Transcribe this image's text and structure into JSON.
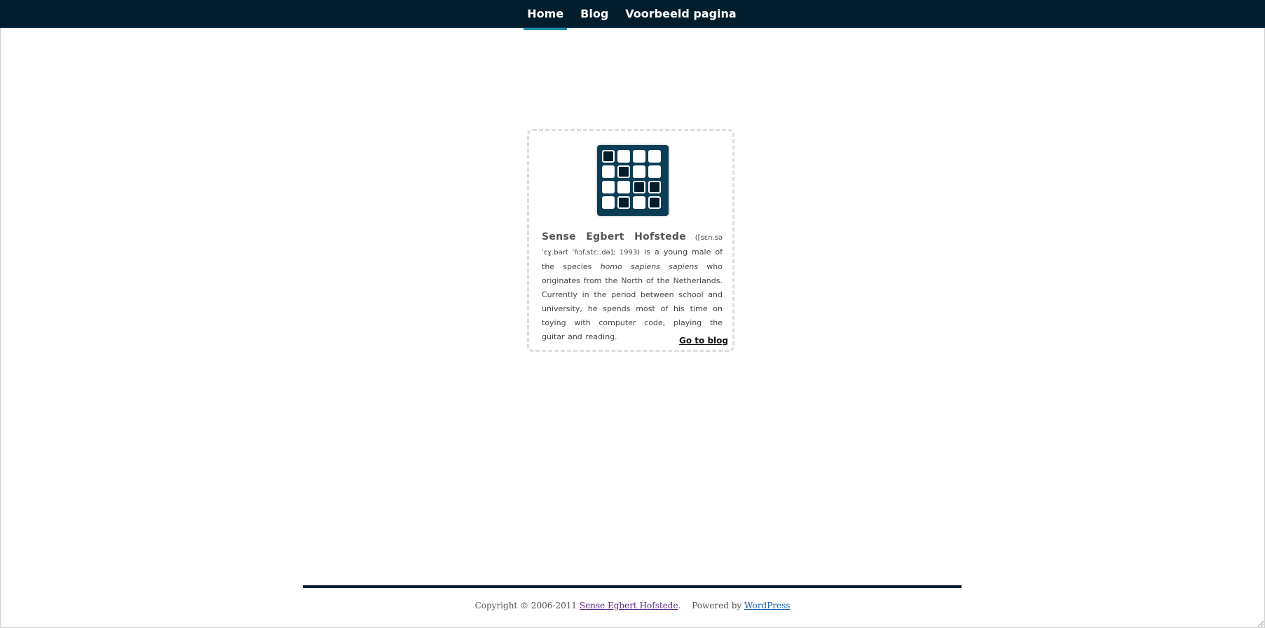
{
  "nav": {
    "items": [
      {
        "label": "Home",
        "active": true
      },
      {
        "label": "Blog",
        "active": false
      },
      {
        "label": "Voorbeeld pagina",
        "active": false
      }
    ]
  },
  "logo": {
    "icon": "grid-logo-icon",
    "pattern": [
      [
        1,
        0,
        0,
        0
      ],
      [
        0,
        1,
        0,
        0
      ],
      [
        0,
        0,
        1,
        1
      ],
      [
        0,
        1,
        0,
        1
      ]
    ]
  },
  "bio": {
    "name": "Sense Egbert Hofstede",
    "pronunciation": "([sɛn.sə ˈɛɣ.bərt ˈɦɔf.stɛː.də]; 1993)",
    "text_before_species": " is a young male of the species ",
    "species": "homo sapiens sapiens",
    "text_after_species": " who originates from the North of the Netherlands. Currently in the period between school and university, he spends most of his time on toying with computer code, playing the guitar and reading."
  },
  "goto_blog": "Go to blog",
  "footer": {
    "copyright": "Copyright © 2006-2011",
    "site_link": "Sense Egbert Hofstede",
    "period": ".",
    "powered": "Powered by",
    "wp_link": "WordPress"
  },
  "colors": {
    "nav_bg": "#021e2e",
    "active_bar": "#1f8fae",
    "logo_bg": "#0b3d57",
    "site_link": "#5b2a86",
    "wp_link": "#1a5fb4"
  }
}
